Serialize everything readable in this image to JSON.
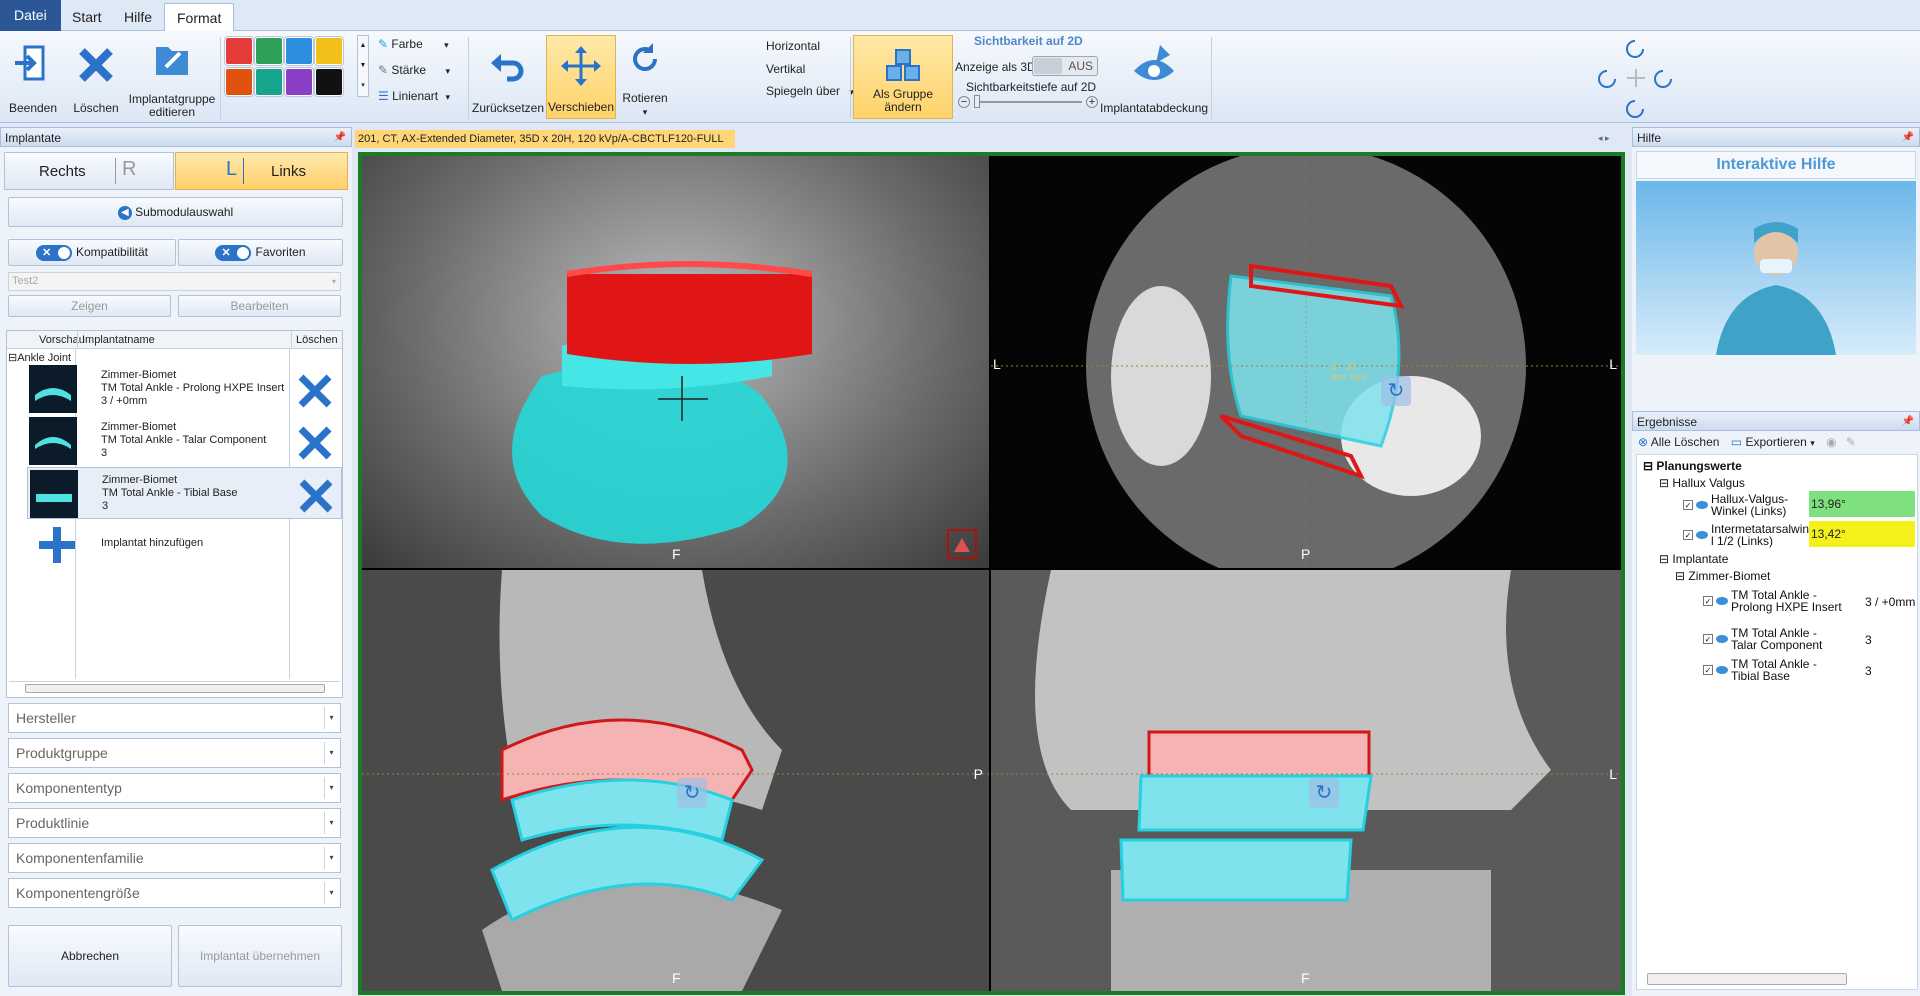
{
  "menu": {
    "tabs": [
      "Datei",
      "Start",
      "Hilfe",
      "Format"
    ],
    "active": "Format"
  },
  "ribbon": {
    "beenden": "Beenden",
    "loeschen": "Löschen",
    "implantatgruppe": [
      "Implantatgruppe",
      "editieren"
    ],
    "farbe": "Farbe",
    "staerke": "Stärke",
    "linienart": "Linienart",
    "zuruecksetzen": "Zurücksetzen",
    "verschieben": "Verschieben",
    "rotieren": "Rotieren",
    "horizontal": "Horizontal",
    "vertikal": "Vertikal",
    "spiegeln": "Spiegeln über",
    "als_gruppe": "Als Gruppe ändern",
    "sichtbarkeit_title": "Sichtbarkeit auf 2D",
    "anzeige": "Anzeige als 3D",
    "aus": "AUS",
    "sichtbarkeitstiefe": "Sichtbarkeitstiefe auf 2D",
    "implantatabdeckung": "Implantatabdeckung",
    "colors": [
      "#e53b3b",
      "#2fa05a",
      "#2e8fe0",
      "#f2c018",
      "#e0530f",
      "#17a58e",
      "#8a3fc6",
      "#111111"
    ]
  },
  "left": {
    "header": "Implantate",
    "rechts": "Rechts",
    "r": "R",
    "l": "L",
    "links": "Links",
    "submodul": "Submodulauswahl",
    "kompatibilitaet": "Kompatibilität",
    "favoriten": "Favoriten",
    "toggle_x": "✕",
    "profile": "Test2",
    "zeigen": "Zeigen",
    "bearbeiten": "Bearbeiten",
    "columns": {
      "vorschau": "Vorschau",
      "name": "Implantatname",
      "loeschen": "Löschen"
    },
    "group": "Ankle Joint",
    "items": [
      {
        "l1": "Zimmer-Biomet",
        "l2": "TM Total Ankle - Prolong HXPE Insert",
        "l3": "3 / +0mm"
      },
      {
        "l1": "Zimmer-Biomet",
        "l2": "TM Total Ankle - Talar Component",
        "l3": "3"
      },
      {
        "l1": "Zimmer-Biomet",
        "l2": "TM Total Ankle - Tibial Base",
        "l3": "3"
      }
    ],
    "add": "Implantat hinzufügen",
    "filters": [
      "Hersteller",
      "Produktgruppe",
      "Komponententyp",
      "Produktlinie",
      "Komponentenfamilie",
      "Komponentengröße"
    ],
    "abbrechen": "Abbrechen",
    "uebernehmen": "Implantat übernehmen"
  },
  "viewer": {
    "title": "201, CT, AX-Extended Diameter, 35D x 20H, 120 kVp/A-CBCTLF120-FULL",
    "q1": {
      "bottom": "F"
    },
    "q2": {
      "left": "L",
      "right": "L",
      "bottom": "P"
    },
    "q3": {
      "right": "P",
      "bottom": "F"
    },
    "q4": {
      "right": "L",
      "bottom": "F"
    },
    "scale": [
      "5",
      "10"
    ],
    "scale_unit": "mm"
  },
  "right": {
    "hilfe": "Hilfe",
    "interaktive": "Interaktive Hilfe",
    "ergebnisse": "Ergebnisse",
    "alle_loeschen": "Alle Löschen",
    "exportieren": "Exportieren",
    "planungswerte": "Planungswerte",
    "hallux": "Hallux Valgus",
    "hva": [
      "Hallux-Valgus-",
      "Winkel (Links)"
    ],
    "hva_val": "13,96°",
    "ima": [
      "Intermetatarsalwinke",
      "l 1/2 (Links)"
    ],
    "ima_val": "13,42°",
    "implantate": "Implantate",
    "zb": "Zimmer-Biomet",
    "res": [
      {
        "a": "TM Total Ankle -",
        "b": "Prolong HXPE Insert",
        "v": "3 / +0mm"
      },
      {
        "a": "TM Total Ankle -",
        "b": "Talar Component",
        "v": "3"
      },
      {
        "a": "TM Total Ankle -",
        "b": "Tibial Base",
        "v": "3"
      }
    ]
  }
}
